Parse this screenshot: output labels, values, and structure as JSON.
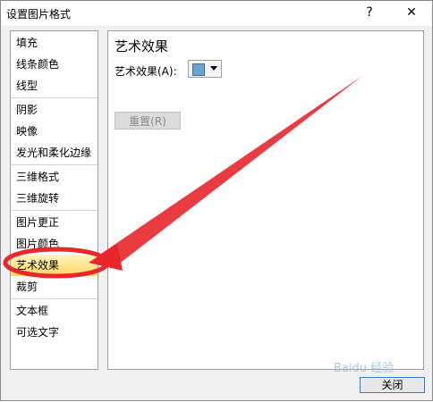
{
  "window": {
    "title": "设置图片格式",
    "help_glyph": "?",
    "close_glyph": "✕"
  },
  "sidebar": {
    "groups": [
      [
        {
          "label": "填充"
        },
        {
          "label": "线条颜色"
        },
        {
          "label": "线型"
        }
      ],
      [
        {
          "label": "阴影"
        },
        {
          "label": "映像"
        },
        {
          "label": "发光和柔化边缘"
        }
      ],
      [
        {
          "label": "三维格式"
        },
        {
          "label": "三维旋转"
        }
      ],
      [
        {
          "label": "图片更正"
        },
        {
          "label": "图片颜色"
        },
        {
          "label": "艺术效果"
        },
        {
          "label": "裁剪"
        }
      ],
      [
        {
          "label": "文本框"
        },
        {
          "label": "可选文字"
        }
      ]
    ],
    "selected": "艺术效果"
  },
  "main": {
    "title": "艺术效果",
    "effect_label": "艺术效果(A):",
    "effect_icon": "artistic-effect-thumbnail-icon",
    "reset_label": "重置(R)"
  },
  "footer": {
    "close_label": "关闭"
  },
  "annotation": {
    "color": "#e8262b"
  },
  "watermark": "Baidu 经验"
}
